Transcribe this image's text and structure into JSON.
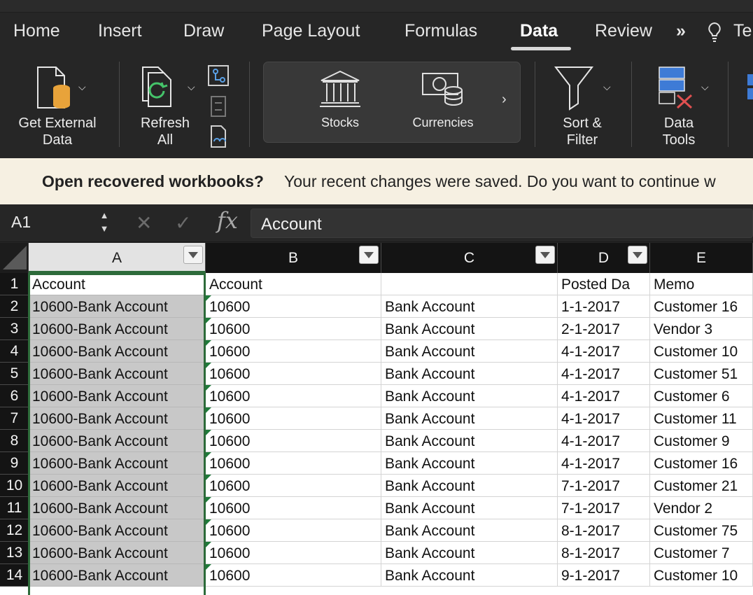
{
  "ribbon_tabs": [
    {
      "label": "Home",
      "active": false
    },
    {
      "label": "Insert",
      "active": false
    },
    {
      "label": "Draw",
      "active": false
    },
    {
      "label": "Page Layout",
      "active": false
    },
    {
      "label": "Formulas",
      "active": false
    },
    {
      "label": "Data",
      "active": true
    },
    {
      "label": "Review",
      "active": false
    },
    {
      "label": "Te",
      "active": false
    }
  ],
  "ribbon": {
    "get_external_data": "Get External\nData",
    "refresh_all": "Refresh\nAll",
    "stocks": "Stocks",
    "currencies": "Currencies",
    "sort_filter": "Sort &\nFilter",
    "data_tools": "Data\nTools"
  },
  "message_bar": {
    "title": "Open recovered workbooks?",
    "text": "Your recent changes were saved. Do you want to continue w"
  },
  "formula_bar": {
    "name_box": "A1",
    "fx": "fx",
    "content": "Account"
  },
  "grid": {
    "columns": [
      "A",
      "B",
      "C",
      "D",
      "E"
    ],
    "header_row": [
      "Account",
      "Account",
      "",
      "Posted Da",
      "Memo"
    ],
    "rows": [
      {
        "num": "1"
      },
      {
        "num": "2",
        "a": "10600-Bank Account",
        "b": "10600",
        "c": "Bank Account",
        "d": "1-1-2017",
        "e": "Customer 16"
      },
      {
        "num": "3",
        "a": "10600-Bank Account",
        "b": "10600",
        "c": "Bank Account",
        "d": "2-1-2017",
        "e": "Vendor 3"
      },
      {
        "num": "4",
        "a": "10600-Bank Account",
        "b": "10600",
        "c": "Bank Account",
        "d": "4-1-2017",
        "e": "Customer 10"
      },
      {
        "num": "5",
        "a": "10600-Bank Account",
        "b": "10600",
        "c": "Bank Account",
        "d": "4-1-2017",
        "e": "Customer 51"
      },
      {
        "num": "6",
        "a": "10600-Bank Account",
        "b": "10600",
        "c": "Bank Account",
        "d": "4-1-2017",
        "e": "Customer 6"
      },
      {
        "num": "7",
        "a": "10600-Bank Account",
        "b": "10600",
        "c": "Bank Account",
        "d": "4-1-2017",
        "e": "Customer 11"
      },
      {
        "num": "8",
        "a": "10600-Bank Account",
        "b": "10600",
        "c": "Bank Account",
        "d": "4-1-2017",
        "e": "Customer 9"
      },
      {
        "num": "9",
        "a": "10600-Bank Account",
        "b": "10600",
        "c": "Bank Account",
        "d": "4-1-2017",
        "e": "Customer 16"
      },
      {
        "num": "10",
        "a": "10600-Bank Account",
        "b": "10600",
        "c": "Bank Account",
        "d": "7-1-2017",
        "e": "Customer 21"
      },
      {
        "num": "11",
        "a": "10600-Bank Account",
        "b": "10600",
        "c": "Bank Account",
        "d": "7-1-2017",
        "e": "Vendor 2"
      },
      {
        "num": "12",
        "a": "10600-Bank Account",
        "b": "10600",
        "c": "Bank Account",
        "d": "8-1-2017",
        "e": "Customer 75"
      },
      {
        "num": "13",
        "a": "10600-Bank Account",
        "b": "10600",
        "c": "Bank Account",
        "d": "8-1-2017",
        "e": "Customer 7"
      },
      {
        "num": "14",
        "a": "10600-Bank Account",
        "b": "10600",
        "c": "Bank Account",
        "d": "9-1-2017",
        "e": "Customer 10"
      }
    ]
  },
  "colors": {
    "selection": "#2d6b3a",
    "selected_column_fill": "#c8c8c8",
    "message_bar": "#f6f0e2",
    "ribbon_bg": "#262626"
  }
}
